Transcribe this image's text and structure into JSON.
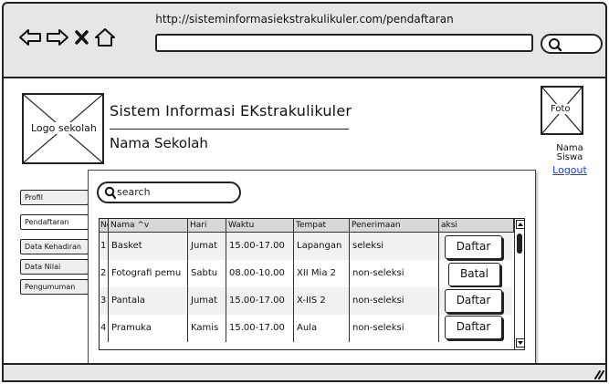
{
  "browser": {
    "url": "http://sisteminformasiekstrakulikuler.com/pendaftaran",
    "nav_icons": [
      "back-arrow-icon",
      "forward-arrow-icon",
      "close-icon",
      "home-icon"
    ],
    "search_icon": "search-icon"
  },
  "header": {
    "logo_label": "Logo sekolah",
    "site_title": "Sistem Informasi EKstrakulikuler",
    "school_name": "Nama Sekolah"
  },
  "user": {
    "photo_label": "Foto",
    "name_label": "Nama\nSiswa",
    "logout_label": "Logout"
  },
  "sidebar": {
    "items": [
      {
        "label": "Profil"
      },
      {
        "label": "Pendaftaran",
        "active": true
      },
      {
        "label": "Data Kehadiran"
      },
      {
        "label": "Data Nilai"
      },
      {
        "label": "Pengumuman"
      }
    ]
  },
  "search": {
    "placeholder": "search"
  },
  "table": {
    "columns": [
      "No",
      "Nama ^v",
      "Hari",
      "Waktu",
      "Tempat",
      "Penerimaan",
      "aksi"
    ],
    "rows": [
      {
        "no": "1",
        "nama": "Basket",
        "hari": "Jumat",
        "waktu": "15.00-17.00",
        "tempat": "Lapangan",
        "penerimaan": "seleksi",
        "aksi": "Daftar"
      },
      {
        "no": "2",
        "nama": "Fotografi pemu",
        "hari": "Sabtu",
        "waktu": "08.00-10.00",
        "tempat": "XII Mia 2",
        "penerimaan": "non-seleksi",
        "aksi": "Batal"
      },
      {
        "no": "3",
        "nama": "Pantala",
        "hari": "Jumat",
        "waktu": "15.00-17.00",
        "tempat": "X-IIS 2",
        "penerimaan": "non-seleksi",
        "aksi": "Daftar"
      },
      {
        "no": "4",
        "nama": "Pramuka",
        "hari": "Kamis",
        "waktu": "15.00-17.00",
        "tempat": "Aula",
        "penerimaan": "non-seleksi",
        "aksi": "Daftar"
      }
    ]
  },
  "colors": {
    "link": "#1a3fd8",
    "chrome_bg": "#e6e6e6"
  }
}
